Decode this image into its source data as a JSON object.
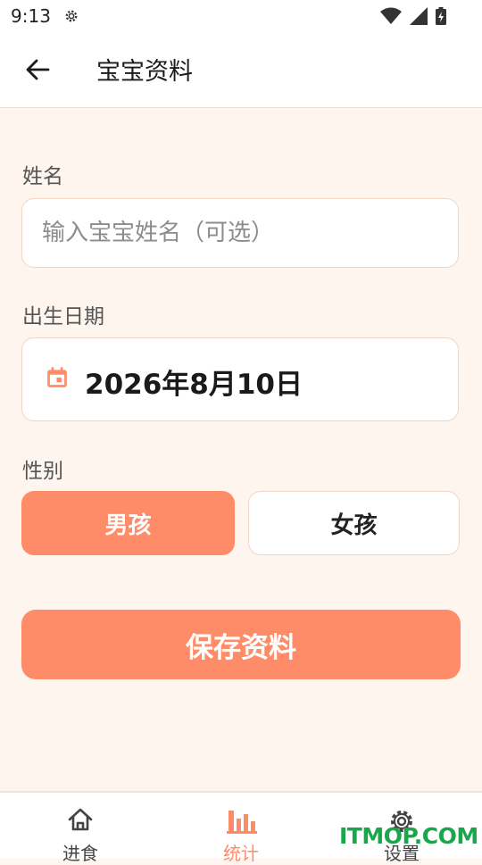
{
  "status_bar": {
    "time": "9:13"
  },
  "app_bar": {
    "title": "宝宝资料"
  },
  "form": {
    "name_label": "姓名",
    "name_placeholder": "输入宝宝姓名（可选）",
    "name_value": "",
    "birth_label": "出生日期",
    "birth_value": "2026年8月10日",
    "gender_label": "性别",
    "gender_options": [
      "男孩",
      "女孩"
    ],
    "gender_selected": "男孩",
    "save_label": "保存资料"
  },
  "bottom_nav": {
    "items": [
      {
        "label": "进食",
        "icon": "home-icon"
      },
      {
        "label": "统计",
        "icon": "bar-chart-icon"
      },
      {
        "label": "设置",
        "icon": "gear-icon"
      }
    ],
    "active": "统计"
  },
  "watermark": "ITMOP.COM",
  "colors": {
    "accent": "#ff8c69",
    "background": "#fdf5ee",
    "card_border": "#efd6c6"
  }
}
